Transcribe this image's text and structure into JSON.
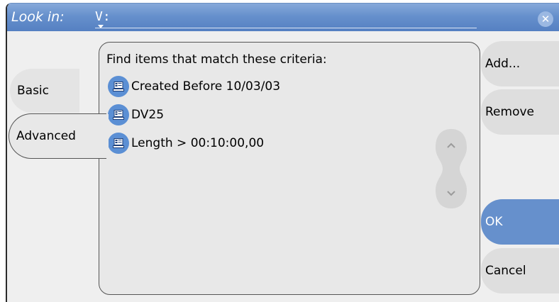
{
  "dialog": {
    "look_in_label": "Look in:",
    "path": "V:",
    "close_symbol": "✕"
  },
  "tabs": [
    {
      "label": "Basic",
      "selected": false
    },
    {
      "label": "Advanced",
      "selected": true
    }
  ],
  "criteria": {
    "heading": "Find items that match these criteria:",
    "items": [
      {
        "label": "Created Before 10/03/03",
        "icon": "criteria-item-icon"
      },
      {
        "label": "DV25",
        "icon": "criteria-item-icon"
      },
      {
        "label": "Length > 00:10:00,00",
        "icon": "criteria-item-icon"
      }
    ]
  },
  "buttons": {
    "add": "Add...",
    "remove": "Remove",
    "ok": "OK",
    "cancel": "Cancel"
  },
  "colors": {
    "accent": "#6690cc",
    "icon_blue": "#5b8fd4",
    "panel": "#e8e8e8",
    "window": "#efefef"
  }
}
